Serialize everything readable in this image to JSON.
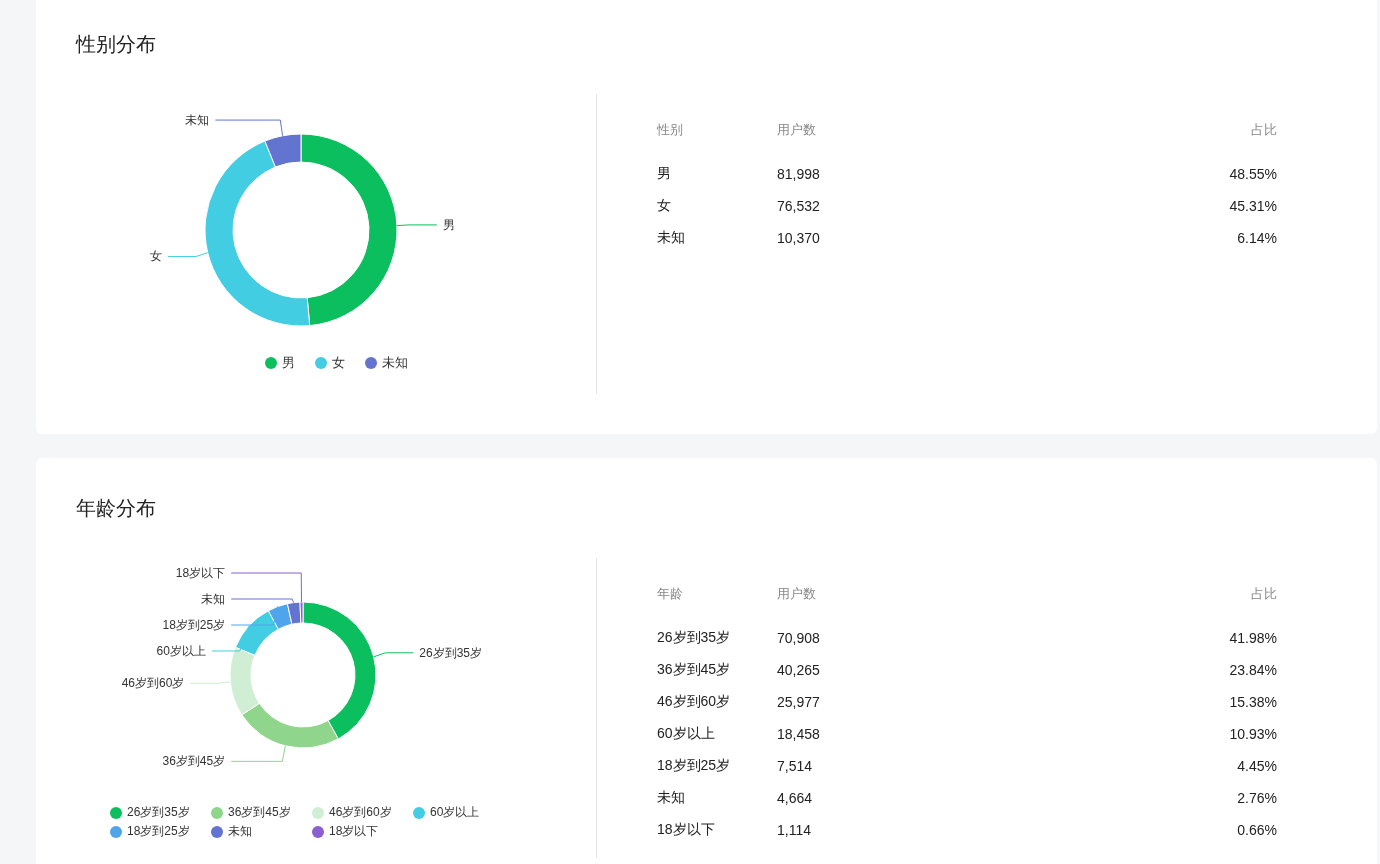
{
  "sections": [
    {
      "title": "性别分布",
      "chart_data": {
        "type": "donut",
        "categories": [
          "男",
          "女",
          "未知"
        ],
        "values": [
          48.55,
          45.31,
          6.14
        ]
      },
      "legend": [
        {
          "label": "男",
          "color": "#0bbf5e"
        },
        {
          "label": "女",
          "color": "#42cde3"
        },
        {
          "label": "未知",
          "color": "#6373d0"
        }
      ],
      "table": {
        "columns": [
          "性别",
          "用户数",
          "占比"
        ],
        "rows": [
          [
            "男",
            "81,998",
            "48.55%"
          ],
          [
            "女",
            "76,532",
            "45.31%"
          ],
          [
            "未知",
            "10,370",
            "6.14%"
          ]
        ]
      }
    },
    {
      "title": "年龄分布",
      "chart_data": {
        "type": "donut",
        "categories": [
          "26岁到35岁",
          "36岁到45岁",
          "46岁到60岁",
          "60岁以上",
          "18岁到25岁",
          "未知",
          "18岁以下"
        ],
        "values": [
          41.98,
          23.84,
          15.38,
          10.93,
          4.45,
          2.76,
          0.66
        ]
      },
      "legend": [
        {
          "label": "26岁到35岁",
          "color": "#0bbf5e"
        },
        {
          "label": "36岁到45岁",
          "color": "#8fd58c"
        },
        {
          "label": "46岁到60岁",
          "color": "#d0eed3"
        },
        {
          "label": "60岁以上",
          "color": "#42cde3"
        },
        {
          "label": "18岁到25岁",
          "color": "#4ea5ec"
        },
        {
          "label": "未知",
          "color": "#6373d0"
        },
        {
          "label": "18岁以下",
          "color": "#8a5fd0"
        }
      ],
      "table": {
        "columns": [
          "年龄",
          "用户数",
          "占比"
        ],
        "rows": [
          [
            "26岁到35岁",
            "70,908",
            "41.98%"
          ],
          [
            "36岁到45岁",
            "40,265",
            "23.84%"
          ],
          [
            "46岁到60岁",
            "25,977",
            "15.38%"
          ],
          [
            "60岁以上",
            "18,458",
            "10.93%"
          ],
          [
            "18岁到25岁",
            "7,514",
            "4.45%"
          ],
          [
            "未知",
            "4,664",
            "2.76%"
          ],
          [
            "18岁以下",
            "1,114",
            "0.66%"
          ]
        ]
      }
    }
  ]
}
